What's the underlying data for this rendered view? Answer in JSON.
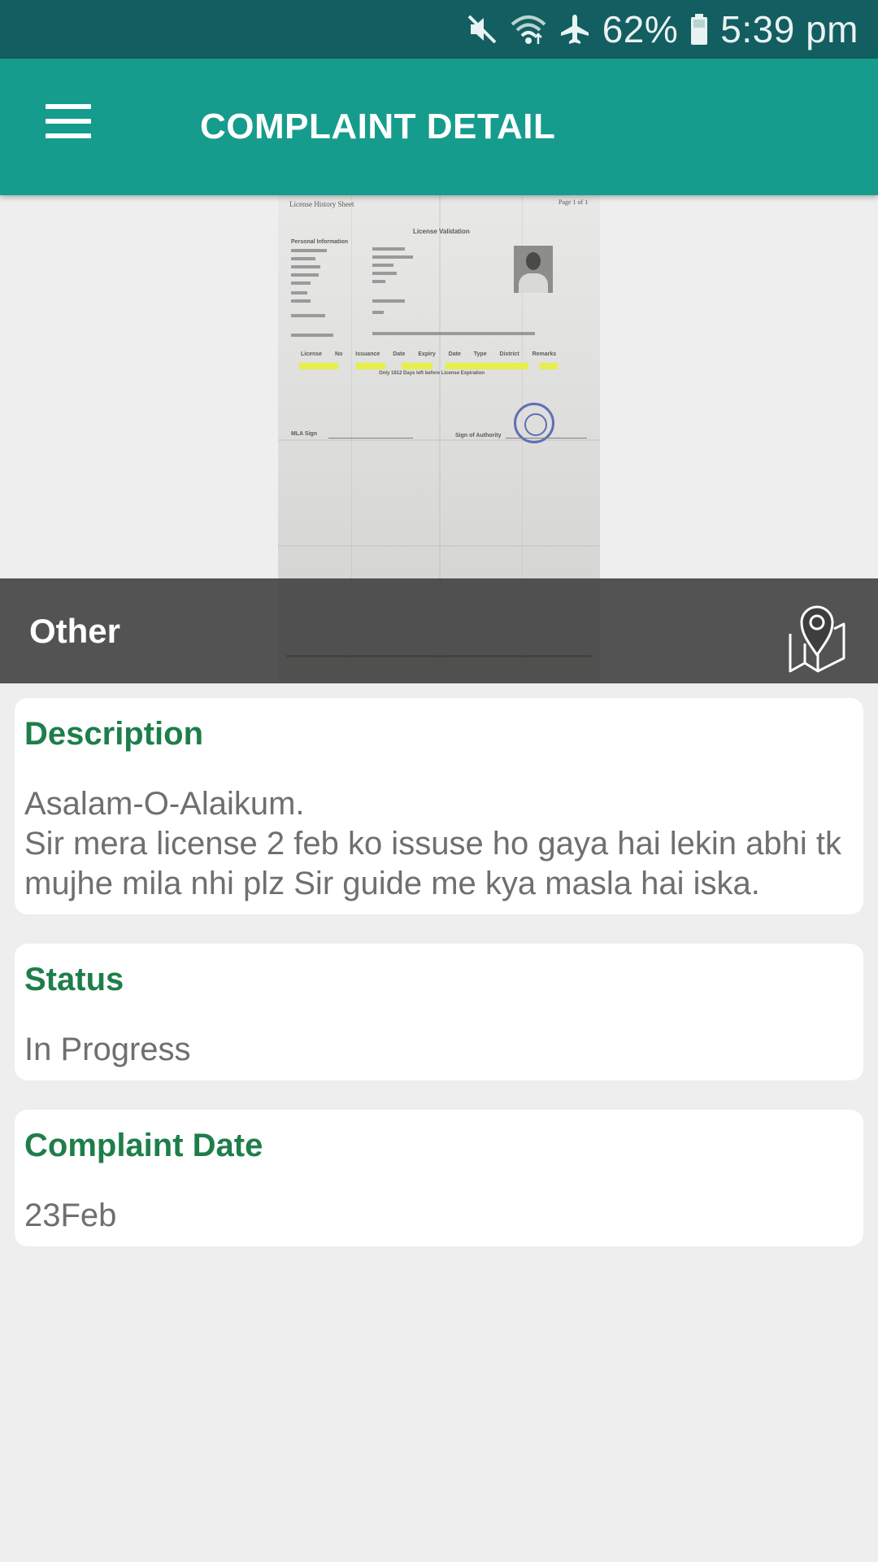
{
  "status_bar": {
    "battery": "62%",
    "time": "5:39 pm",
    "icons": [
      "mute-icon",
      "wifi-icon",
      "airplane-mode-icon",
      "battery-icon"
    ]
  },
  "app_bar": {
    "title": "COMPLAINT DETAIL",
    "menu_icon": "hamburger-menu-icon"
  },
  "complaint": {
    "category": "Other",
    "map_icon": "map-pin-icon",
    "attachment": {
      "document_heading": "License History Sheet",
      "document_page": "Page 1 of 1",
      "document_title": "License Validation",
      "section_label": "Personal Information",
      "sign_left": "MLA Sign",
      "sign_right": "Sign of Authority",
      "table_headers": [
        "License No",
        "Issuance Date",
        "Expiry Date",
        "Type",
        "District",
        "Remarks"
      ],
      "expiry_note": "Only 1812 Days left before License Expiration"
    },
    "description": {
      "label": "Description",
      "text": "Asalam-O-Alaikum.\nSir mera license 2 feb ko issuse ho gaya hai lekin abhi tk mujhe mila nhi plz Sir guide me kya masla hai iska."
    },
    "status": {
      "label": "Status",
      "value": "In Progress"
    },
    "date": {
      "label": "Complaint Date",
      "value": "23Feb"
    }
  },
  "colors": {
    "status_bar": "#135e60",
    "app_bar": "#169c8d",
    "label_green": "#1e7e4a",
    "body_text": "#6f6f6f",
    "background": "#eeeeee"
  }
}
